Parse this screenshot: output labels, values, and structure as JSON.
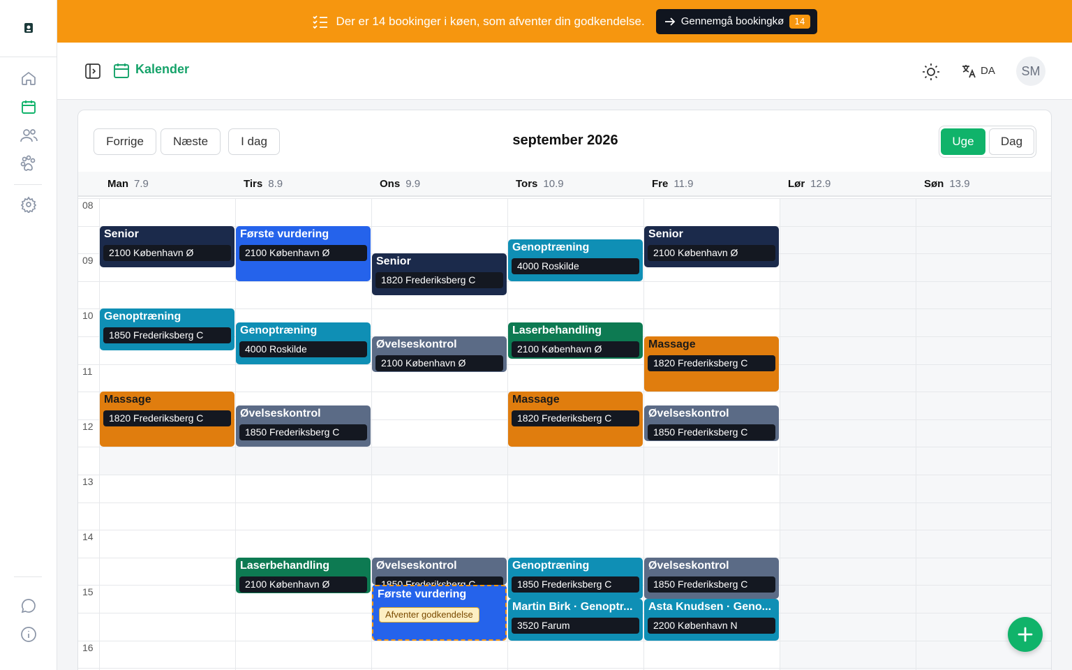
{
  "banner": {
    "text": "Der er 14 bookinger i køen, som afventer din godkendelse.",
    "button_label": "Gennemgå bookingkø",
    "badge": "14",
    "color": "#f6960f"
  },
  "header": {
    "title": "Kalender",
    "language": "DA",
    "avatar_initials": "SM"
  },
  "sidebar": {
    "items": [
      {
        "icon": "home-icon"
      },
      {
        "icon": "calendar-icon",
        "active": true
      },
      {
        "icon": "users-icon"
      },
      {
        "icon": "paw-icon"
      },
      {
        "icon": "gear-icon"
      },
      {
        "icon": "chat-icon"
      },
      {
        "icon": "info-icon"
      }
    ]
  },
  "toolbar": {
    "prev": "Forrige",
    "next": "Næste",
    "today": "I dag",
    "month": "september 2026",
    "view_week": "Uge",
    "view_day": "Dag",
    "active_view": "Uge"
  },
  "days": [
    {
      "name": "Man",
      "date": "7.9"
    },
    {
      "name": "Tirs",
      "date": "8.9"
    },
    {
      "name": "Ons",
      "date": "9.9"
    },
    {
      "name": "Tors",
      "date": "10.9"
    },
    {
      "name": "Fre",
      "date": "11.9"
    },
    {
      "name": "Lør",
      "date": "12.9"
    },
    {
      "name": "Søn",
      "date": "13.9"
    }
  ],
  "hours": [
    "08",
    "09",
    "10",
    "11",
    "12",
    "13",
    "14",
    "15",
    "16"
  ],
  "events": [
    {
      "day": 0,
      "start": 8.5,
      "end": 9.25,
      "title": "Senior",
      "sub": "2100 København Ø",
      "color": "#1b2a4b"
    },
    {
      "day": 0,
      "start": 10.0,
      "end": 10.75,
      "title": "Genoptræning",
      "sub": "1850 Frederiksberg C",
      "color": "#0f8fb5"
    },
    {
      "day": 0,
      "start": 11.5,
      "end": 12.5,
      "title": "Massage",
      "sub": "1820 Frederiksberg C",
      "color": "#e07d0e",
      "dark_title": true
    },
    {
      "day": 1,
      "start": 8.5,
      "end": 9.5,
      "title": "Første vurdering",
      "sub": "2100 København Ø",
      "color": "#2563eb"
    },
    {
      "day": 1,
      "start": 10.25,
      "end": 11.0,
      "title": "Genoptræning",
      "sub": "4000 Roskilde",
      "color": "#0f8fb5"
    },
    {
      "day": 1,
      "start": 11.75,
      "end": 12.5,
      "title": "Øvelseskontrol",
      "sub": "1850 Frederiksberg C",
      "color": "#5b6b86"
    },
    {
      "day": 1,
      "start": 14.5,
      "end": 15.15,
      "title": "Laserbehandling",
      "sub": "2100 København Ø",
      "color": "#0d7a52"
    },
    {
      "day": 2,
      "start": 9.0,
      "end": 9.75,
      "title": "Senior",
      "sub": "1820 Frederiksberg C",
      "color": "#1b2a4b"
    },
    {
      "day": 2,
      "start": 10.5,
      "end": 11.15,
      "title": "Øvelseskontrol",
      "sub": "2100 København Ø",
      "color": "#5b6b86"
    },
    {
      "day": 2,
      "start": 14.5,
      "end": 15.0,
      "title": "Øvelseskontrol",
      "sub": "1850 Frederiksberg C",
      "color": "#5b6b86"
    },
    {
      "day": 2,
      "start": 15.0,
      "end": 16.0,
      "title": "Første vurdering",
      "tag": "Afventer godkendelse",
      "color": "#2563eb",
      "pending": true
    },
    {
      "day": 3,
      "start": 8.75,
      "end": 9.5,
      "title": "Genoptræning",
      "sub": "4000 Roskilde",
      "color": "#0f8fb5"
    },
    {
      "day": 3,
      "start": 10.25,
      "end": 10.9,
      "title": "Laserbehandling",
      "sub": "2100 København Ø",
      "color": "#0d7a52"
    },
    {
      "day": 3,
      "start": 11.5,
      "end": 12.5,
      "title": "Massage",
      "sub": "1820 Frederiksberg C",
      "color": "#e07d0e",
      "dark_title": true
    },
    {
      "day": 3,
      "start": 14.5,
      "end": 15.25,
      "title": "Genoptræning",
      "sub": "1850 Frederiksberg C",
      "color": "#0f8fb5"
    },
    {
      "day": 3,
      "start": 15.25,
      "end": 16.0,
      "title": "Martin Birk · Genoptr...",
      "sub": "3520 Farum",
      "color": "#0f8fb5"
    },
    {
      "day": 4,
      "start": 8.5,
      "end": 9.25,
      "title": "Senior",
      "sub": "2100 København Ø",
      "color": "#1b2a4b"
    },
    {
      "day": 4,
      "start": 10.5,
      "end": 11.5,
      "title": "Massage",
      "sub": "1820 Frederiksberg C",
      "color": "#e07d0e",
      "dark_title": true
    },
    {
      "day": 4,
      "start": 11.75,
      "end": 12.4,
      "title": "Øvelseskontrol",
      "sub": "1850 Frederiksberg C",
      "color": "#5b6b86"
    },
    {
      "day": 4,
      "start": 14.5,
      "end": 15.25,
      "title": "Øvelseskontrol",
      "sub": "1850 Frederiksberg C",
      "color": "#5b6b86"
    },
    {
      "day": 4,
      "start": 15.25,
      "end": 16.0,
      "title": "Asta Knudsen · Geno...",
      "sub": "2200 København N",
      "color": "#0f8fb5"
    }
  ]
}
